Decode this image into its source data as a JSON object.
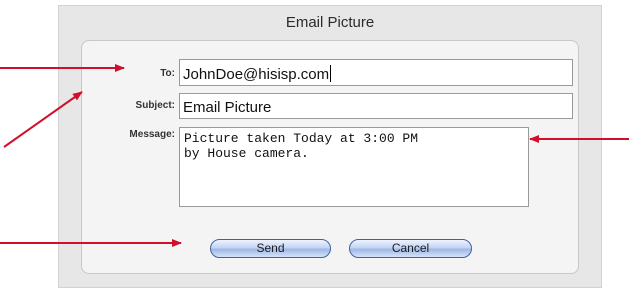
{
  "dialog": {
    "title": "Email Picture"
  },
  "form": {
    "to_label": "To:",
    "to_value": "JohnDoe@hisisp.com",
    "subject_label": "Subject:",
    "subject_value": "Email Picture",
    "message_label": "Message:",
    "message_value": "Picture taken Today at 3:00 PM\nby House camera."
  },
  "buttons": {
    "send_label": "Send",
    "cancel_label": "Cancel"
  },
  "colors": {
    "arrow": "#d0102a",
    "button_border": "#43609a"
  }
}
